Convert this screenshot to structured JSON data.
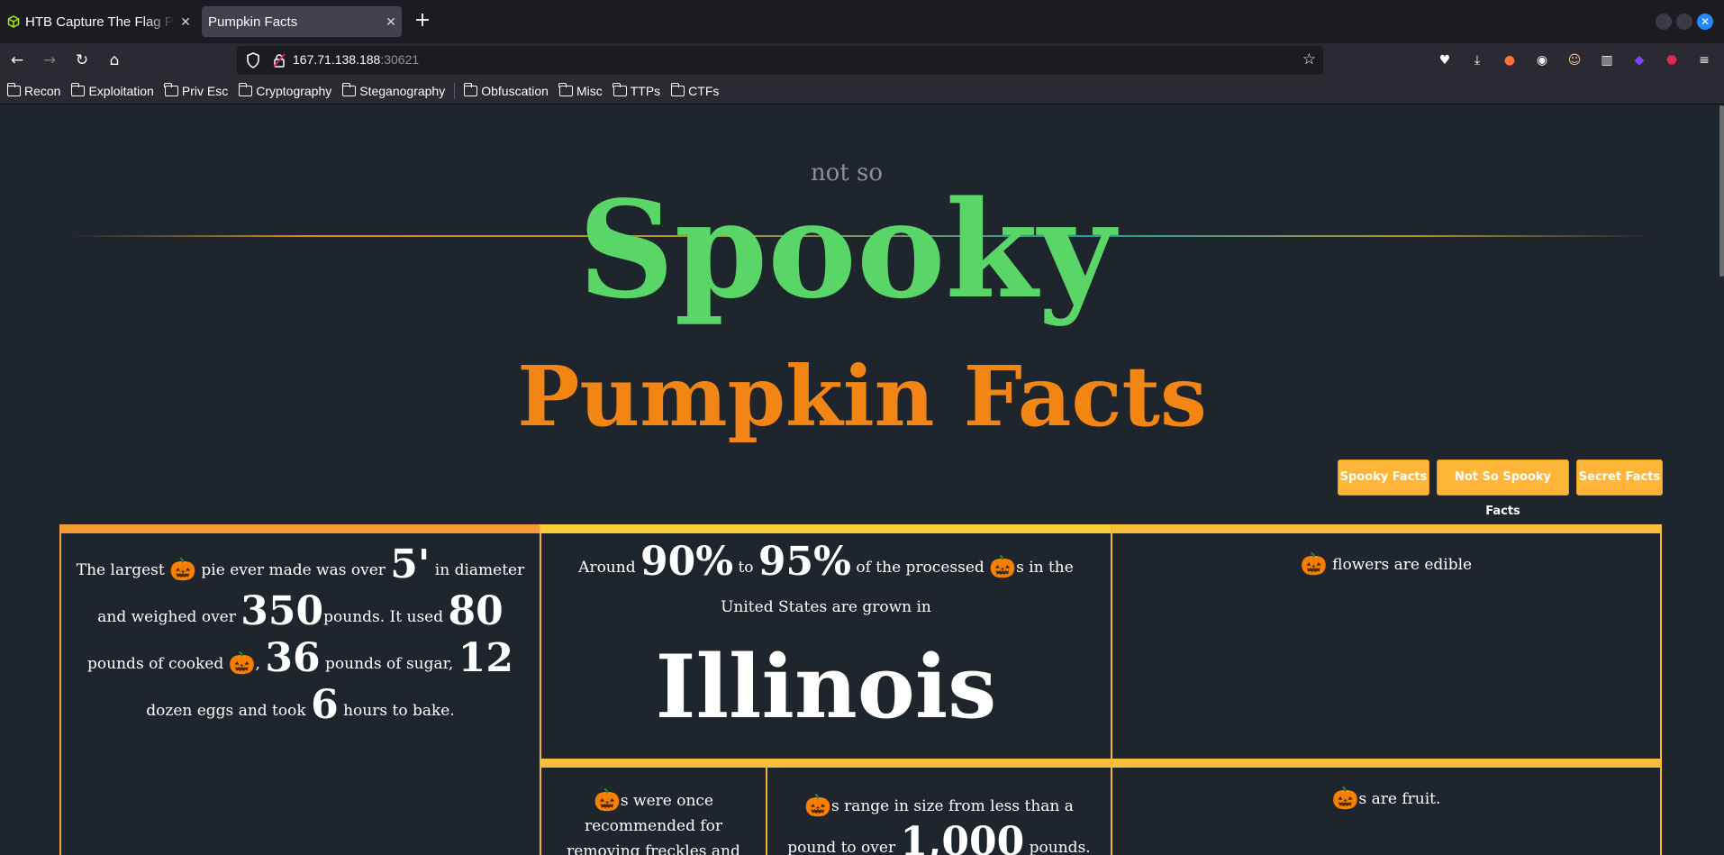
{
  "browser": {
    "tabs": [
      {
        "title": "HTB Capture The Flag Pla",
        "active": false
      },
      {
        "title": "Pumpkin Facts",
        "active": true
      }
    ],
    "url_host": "167.71.138.188",
    "url_port": ":30621",
    "bookmarks": [
      "Recon",
      "Exploitation",
      "Priv Esc",
      "Cryptography",
      "Steganography",
      "Obfuscation",
      "Misc",
      "TTPs",
      "CTFs"
    ]
  },
  "header": {
    "small": "not so",
    "main": "Spooky",
    "subtitle": "Pumpkin Facts"
  },
  "buttons": {
    "spooky": "Spooky Facts",
    "not_so_spooky": "Not So Spooky Facts",
    "secret": "Secret Facts"
  },
  "facts": {
    "pie": {
      "t1": "The largest ",
      "t2": " pie ever made was over ",
      "n1": "5'",
      "t3": " in diameter and weighed over ",
      "n2": "350",
      "t4": "pounds. It used ",
      "n3": "80",
      "t5": " pounds of cooked ",
      "t6": ", ",
      "n4": "36",
      "t7": " pounds of sugar, ",
      "n5": "12",
      "t8": " dozen eggs and took ",
      "n6": "6",
      "t9": " hours to bake."
    },
    "illinois": {
      "t1": "Around ",
      "n1": "90%",
      "t2": " to ",
      "n2": "95%",
      "t3": " of the processed ",
      "t4": "s in the United States are grown in",
      "state": "Illinois"
    },
    "flowers": " flowers are edible",
    "freckles": "s were once recommended for removing freckles and",
    "size": {
      "t1": "s range in size from less than a pound to over ",
      "n1": "1,000",
      "t2": " pounds."
    },
    "fruit": "s are fruit."
  },
  "emoji": "🎃",
  "colors": {
    "spooky_green": "#59d667",
    "pumpkin_orange": "#f28513",
    "button": "#ffb638",
    "card_border": "#f5b63a",
    "background": "#1e252c"
  }
}
